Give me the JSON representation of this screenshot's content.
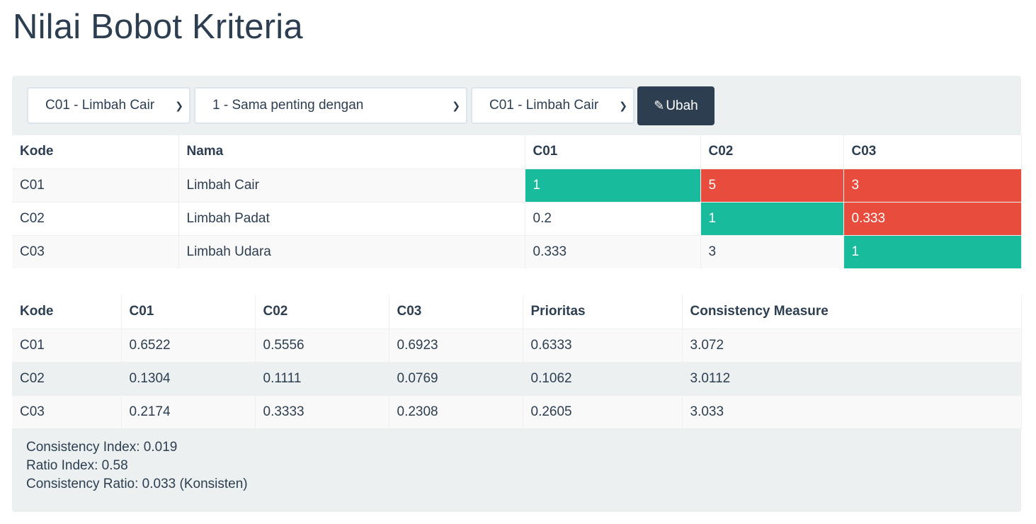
{
  "page_title": "Nilai Bobot Kriteria",
  "form": {
    "select_left": "C01 - Limbah Cair",
    "select_scale": "1 - Sama penting dengan",
    "select_right": "C01 - Limbah Cair",
    "button_label": "Ubah",
    "button_icon": "edit-icon"
  },
  "matrix": {
    "headers": [
      "Kode",
      "Nama",
      "C01",
      "C02",
      "C03"
    ],
    "rows": [
      {
        "kode": "C01",
        "nama": "Limbah Cair",
        "c01": "1",
        "c02": "5",
        "c03": "3"
      },
      {
        "kode": "C02",
        "nama": "Limbah Padat",
        "c01": "0.2",
        "c02": "1",
        "c03": "0.333"
      },
      {
        "kode": "C03",
        "nama": "Limbah Udara",
        "c01": "0.333",
        "c02": "3",
        "c03": "1"
      }
    ]
  },
  "normalized": {
    "headers": [
      "Kode",
      "C01",
      "C02",
      "C03",
      "Prioritas",
      "Consistency Measure"
    ],
    "rows": [
      {
        "kode": "C01",
        "c01": "0.6522",
        "c02": "0.5556",
        "c03": "0.6923",
        "prioritas": "0.6333",
        "cm": "3.072"
      },
      {
        "kode": "C02",
        "c01": "0.1304",
        "c02": "0.1111",
        "c03": "0.0769",
        "prioritas": "0.1062",
        "cm": "3.0112"
      },
      {
        "kode": "C03",
        "c01": "0.2174",
        "c02": "0.3333",
        "c03": "0.2308",
        "prioritas": "0.2605",
        "cm": "3.033"
      }
    ]
  },
  "summary": {
    "consistency_index": "Consistency Index: 0.019",
    "ratio_index": "Ratio Index: 0.58",
    "consistency_ratio": "Consistency Ratio: 0.033 (Konsisten)"
  },
  "colors": {
    "diagonal": "#18bc9c",
    "upper": "#e74c3c",
    "primary": "#2c3e50",
    "panel": "#ecf0f1"
  }
}
